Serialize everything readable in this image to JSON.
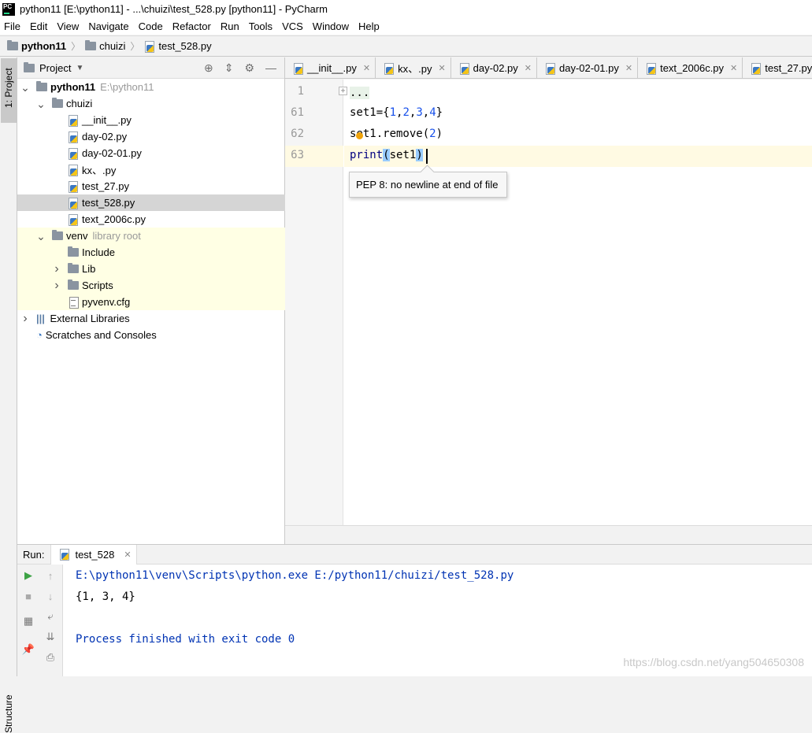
{
  "window": {
    "title": "python11 [E:\\python11] - ...\\chuizi\\test_528.py [python11] - PyCharm",
    "logo_text": "PC"
  },
  "menu": [
    "File",
    "Edit",
    "View",
    "Navigate",
    "Code",
    "Refactor",
    "Run",
    "Tools",
    "VCS",
    "Window",
    "Help"
  ],
  "breadcrumb": [
    "python11",
    "chuizi",
    "test_528.py"
  ],
  "left_strip": {
    "project_tab": "1: Project",
    "structure_tab": "Structure"
  },
  "project_panel": {
    "title": "Project",
    "tree": [
      {
        "label": "python11",
        "extra": "E:\\python11",
        "depth": 0,
        "arrow": "down",
        "icon": "folder",
        "bold": true
      },
      {
        "label": "chuizi",
        "depth": 1,
        "arrow": "down",
        "icon": "folder"
      },
      {
        "label": "__init__.py",
        "depth": 2,
        "icon": "pyfile"
      },
      {
        "label": "day-02.py",
        "depth": 2,
        "icon": "pyfile"
      },
      {
        "label": "day-02-01.py",
        "depth": 2,
        "icon": "pyfile"
      },
      {
        "label": "kx、.py",
        "depth": 2,
        "icon": "pyfile"
      },
      {
        "label": "test_27.py",
        "depth": 2,
        "icon": "pyfile"
      },
      {
        "label": "test_528.py",
        "depth": 2,
        "icon": "pyfile",
        "selected": true
      },
      {
        "label": "text_2006c.py",
        "depth": 2,
        "icon": "pyfile"
      },
      {
        "label": "venv",
        "extra": "library root",
        "depth": 1,
        "arrow": "down",
        "icon": "folder",
        "yellow": true
      },
      {
        "label": "Include",
        "depth": 2,
        "icon": "folder",
        "yellow": true
      },
      {
        "label": "Lib",
        "depth": 2,
        "arrow": "right",
        "icon": "folder",
        "yellow": true
      },
      {
        "label": "Scripts",
        "depth": 2,
        "arrow": "right",
        "icon": "folder",
        "yellow": true
      },
      {
        "label": "pyvenv.cfg",
        "depth": 2,
        "icon": "cfg",
        "yellow": true
      },
      {
        "label": "External Libraries",
        "depth": 0,
        "arrow": "right",
        "icon": "libs"
      },
      {
        "label": "Scratches and Consoles",
        "depth": 0,
        "icon": "scratch"
      }
    ]
  },
  "tabs": [
    "__init__.py",
    "kx、.py",
    "day-02.py",
    "day-02-01.py",
    "text_2006c.py",
    "test_27.py"
  ],
  "editor": {
    "lines": [
      {
        "n": "1",
        "text": "..."
      },
      {
        "n": "61",
        "text": "set1={1,2,3,4}"
      },
      {
        "n": "62",
        "text": "set1.remove(2)"
      },
      {
        "n": "63",
        "text": "print(set1)"
      }
    ],
    "tooltip": "PEP 8: no newline at end of file"
  },
  "run": {
    "label": "Run:",
    "tab": "test_528",
    "output": [
      "E:\\python11\\venv\\Scripts\\python.exe E:/python11/chuizi/test_528.py",
      "{1, 3, 4}",
      "",
      "Process finished with exit code 0"
    ],
    "watermark": "https://blog.csdn.net/yang504650308"
  },
  "colors": {
    "console_blue": "#0033b3",
    "number": "#1750eb",
    "builtin": "#000080",
    "selection": "#d5d5d5",
    "venv_bg": "#ffffe4"
  }
}
